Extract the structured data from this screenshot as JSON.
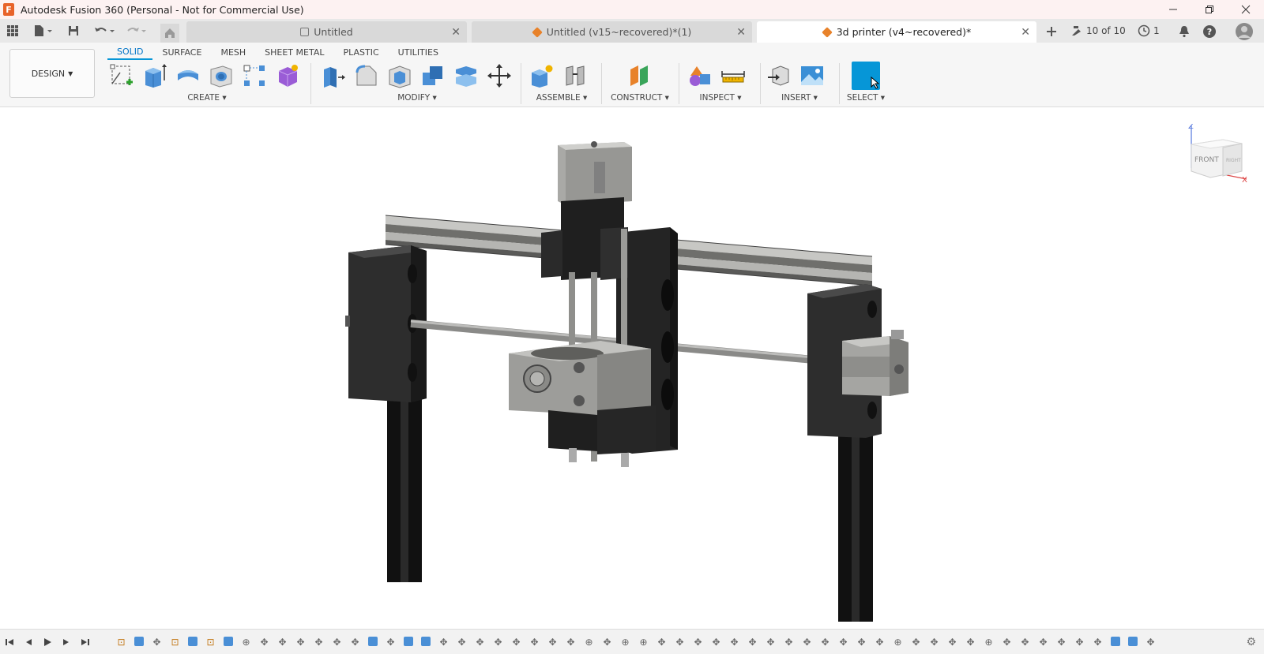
{
  "window": {
    "title": "Autodesk Fusion 360 (Personal - Not for Commercial Use)",
    "app_logo_letter": "F"
  },
  "tabs": [
    {
      "label": "Untitled",
      "active": false,
      "locked": true
    },
    {
      "label": "Untitled (v15~recovered)*(1)",
      "active": false,
      "locked": false
    },
    {
      "label": "3d printer (v4~recovered)*",
      "active": true,
      "locked": false
    }
  ],
  "tabbar_right": {
    "jobs_label": "10 of 10",
    "history_count": "1"
  },
  "toolbar": {
    "workspace_label": "DESIGN",
    "workspace_tabs": [
      "SOLID",
      "SURFACE",
      "MESH",
      "SHEET METAL",
      "PLASTIC",
      "UTILITIES"
    ],
    "active_workspace_tab": "SOLID",
    "groups": {
      "create": "CREATE",
      "modify": "MODIFY",
      "assemble": "ASSEMBLE",
      "construct": "CONSTRUCT",
      "inspect": "INSPECT",
      "insert": "INSERT",
      "select": "SELECT"
    }
  },
  "viewcube": {
    "front_label": "FRONT",
    "right_label": "RIGHT",
    "axis_z": "Z",
    "axis_x": "X"
  },
  "colors": {
    "accent": "#0696d7",
    "part_dark": "#2b2b2b",
    "part_grey": "#9a9a98",
    "rail": "#b8b8b5"
  }
}
